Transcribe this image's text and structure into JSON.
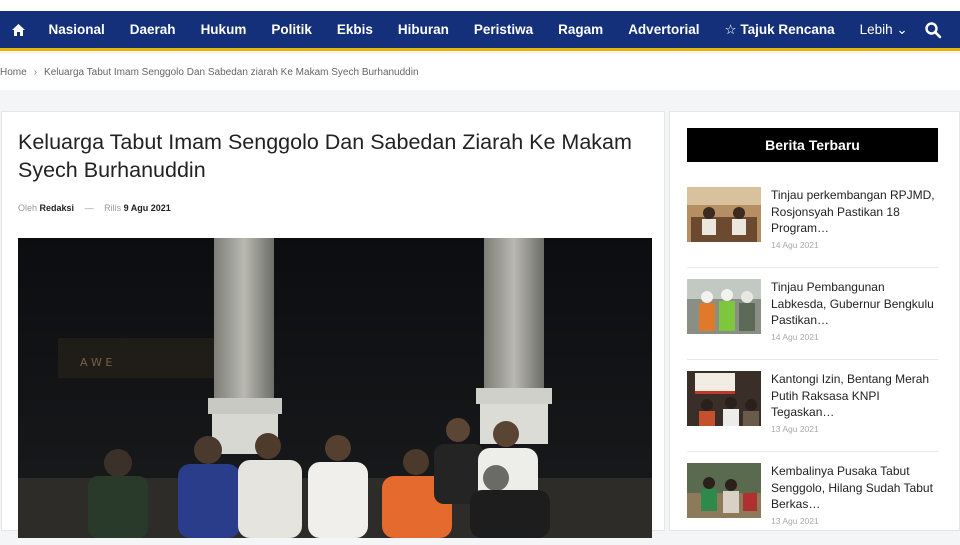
{
  "nav": {
    "home_icon": "home-icon",
    "items": [
      "Nasional",
      "Daerah",
      "Hukum",
      "Politik",
      "Ekbis",
      "Hiburan",
      "Peristiwa",
      "Ragam",
      "Advertorial",
      "☆ Tajuk Rencana",
      "Lebih ⌄"
    ],
    "search_icon": "search-icon",
    "colors": {
      "bar": "#14307a",
      "accent": "#e9b400"
    }
  },
  "breadcrumb": {
    "home": "Home",
    "separator": "›",
    "current": "Keluarga Tabut Imam Senggolo Dan Sabedan ziarah Ke Makam Syech Burhanuddin"
  },
  "article": {
    "title": "Keluarga Tabut Imam Senggolo Dan Sabedan Ziarah Ke Makam Syech Burhanuddin",
    "author_prefix": "Oleh",
    "author": "Redaksi",
    "dash": "—",
    "date_prefix": "Rilis",
    "date": "9 Agu 2021"
  },
  "sidebar": {
    "heading": "Berita Terbaru",
    "items": [
      {
        "title": "Tinjau perkembangan RPJMD, Rosjonsyah Pastikan 18 Program…",
        "date": "14 Agu 2021"
      },
      {
        "title": "Tinjau Pembangunan Labkesda, Gubernur Bengkulu Pastikan…",
        "date": "14 Agu 2021"
      },
      {
        "title": "Kantongi Izin, Bentang Merah Putih Raksasa KNPI Tegaskan…",
        "date": "13 Agu 2021"
      },
      {
        "title": "Kembalinya Pusaka Tabut Senggolo, Hilang Sudah Tabut Berkas…",
        "date": "13 Agu 2021"
      }
    ]
  }
}
